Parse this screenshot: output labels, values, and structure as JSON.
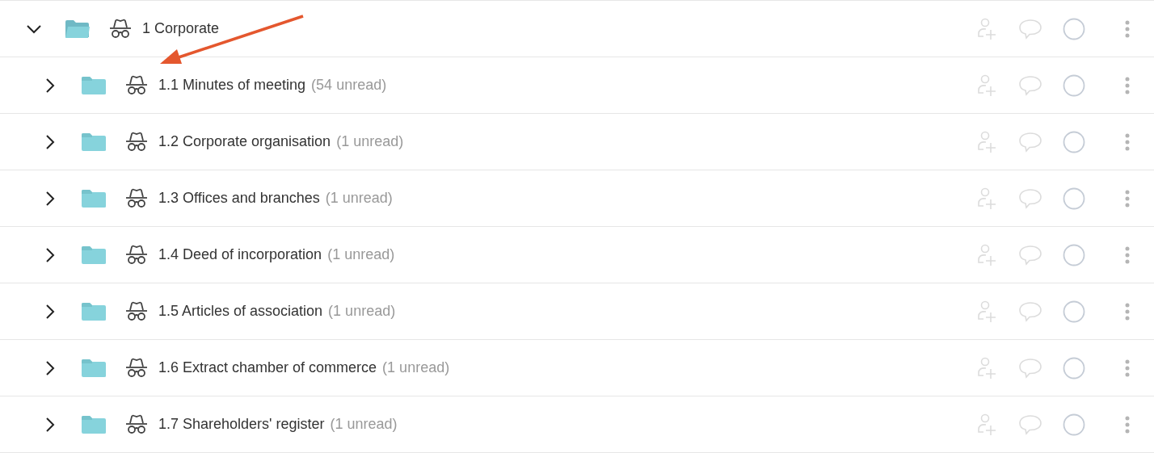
{
  "folder": {
    "title": "1 Corporate",
    "expanded": true,
    "children": [
      {
        "title": "1.1 Minutes of meeting",
        "unread": "(54 unread)",
        "expanded": false
      },
      {
        "title": "1.2 Corporate organisation",
        "unread": "(1 unread)",
        "expanded": false
      },
      {
        "title": "1.3 Offices and branches",
        "unread": "(1 unread)",
        "expanded": false
      },
      {
        "title": "1.4 Deed of incorporation",
        "unread": "(1 unread)",
        "expanded": false
      },
      {
        "title": "1.5 Articles of association",
        "unread": "(1 unread)",
        "expanded": false
      },
      {
        "title": "1.6 Extract chamber of commerce",
        "unread": "(1 unread)",
        "expanded": false
      },
      {
        "title": "1.7 Shareholders' register",
        "unread": "(1 unread)",
        "expanded": false
      }
    ]
  }
}
